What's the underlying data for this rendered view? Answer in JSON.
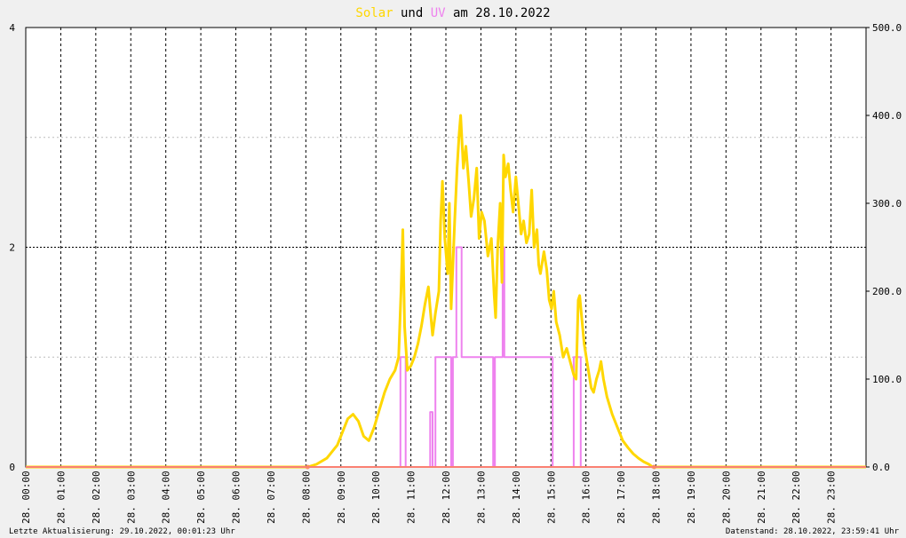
{
  "chart_data": {
    "type": "line",
    "title_parts": [
      {
        "text": "Solar",
        "color": "#FFD700"
      },
      {
        "text": " und ",
        "color": "#000000"
      },
      {
        "text": "UV",
        "color": "#EE82EE"
      },
      {
        "text": " am 28.10.2022",
        "color": "#000000"
      }
    ],
    "x_unit": "hours",
    "xlim": [
      0,
      24
    ],
    "x_tick_labels": [
      "28. 00:00",
      "28. 01:00",
      "28. 02:00",
      "28. 03:00",
      "28. 04:00",
      "28. 05:00",
      "28. 06:00",
      "28. 07:00",
      "28. 08:00",
      "28. 09:00",
      "28. 10:00",
      "28. 11:00",
      "28. 12:00",
      "28. 13:00",
      "28. 14:00",
      "28. 15:00",
      "28. 16:00",
      "28. 17:00",
      "28. 18:00",
      "28. 19:00",
      "28. 20:00",
      "28. 21:00",
      "28. 22:00",
      "28. 23:00"
    ],
    "y_left": {
      "lim": [
        0,
        4
      ],
      "ticks": [
        0,
        2,
        4
      ],
      "tick_labels": [
        "0",
        "2",
        "4"
      ],
      "minor_ticks": [
        1,
        3
      ]
    },
    "y_right": {
      "lim": [
        0,
        500
      ],
      "ticks": [
        0,
        100,
        200,
        300,
        400,
        500
      ],
      "tick_labels": [
        "0.0",
        "100.0",
        "200.0",
        "300.0",
        "400.0",
        "500.0"
      ]
    },
    "grid": true,
    "series": [
      {
        "name": "Solar",
        "color": "#FFD700",
        "axis": "right",
        "points": [
          [
            0,
            0
          ],
          [
            8.05,
            0
          ],
          [
            8.3,
            3
          ],
          [
            8.6,
            10
          ],
          [
            8.9,
            25
          ],
          [
            9.05,
            40
          ],
          [
            9.2,
            55
          ],
          [
            9.35,
            60
          ],
          [
            9.5,
            52
          ],
          [
            9.65,
            35
          ],
          [
            9.8,
            30
          ],
          [
            9.95,
            45
          ],
          [
            10.1,
            65
          ],
          [
            10.25,
            85
          ],
          [
            10.4,
            100
          ],
          [
            10.55,
            110
          ],
          [
            10.65,
            125
          ],
          [
            10.72,
            200
          ],
          [
            10.77,
            270
          ],
          [
            10.82,
            160
          ],
          [
            10.9,
            110
          ],
          [
            11.0,
            115
          ],
          [
            11.1,
            125
          ],
          [
            11.2,
            140
          ],
          [
            11.3,
            160
          ],
          [
            11.4,
            185
          ],
          [
            11.5,
            205
          ],
          [
            11.55,
            180
          ],
          [
            11.62,
            150
          ],
          [
            11.7,
            175
          ],
          [
            11.8,
            200
          ],
          [
            11.85,
            280
          ],
          [
            11.9,
            325
          ],
          [
            11.97,
            260
          ],
          [
            12.05,
            220
          ],
          [
            12.1,
            300
          ],
          [
            12.15,
            180
          ],
          [
            12.25,
            280
          ],
          [
            12.32,
            340
          ],
          [
            12.38,
            380
          ],
          [
            12.42,
            400
          ],
          [
            12.5,
            340
          ],
          [
            12.57,
            365
          ],
          [
            12.65,
            325
          ],
          [
            12.72,
            285
          ],
          [
            12.8,
            305
          ],
          [
            12.88,
            340
          ],
          [
            12.95,
            260
          ],
          [
            13.02,
            290
          ],
          [
            13.1,
            280
          ],
          [
            13.2,
            240
          ],
          [
            13.3,
            260
          ],
          [
            13.38,
            195
          ],
          [
            13.42,
            170
          ],
          [
            13.48,
            250
          ],
          [
            13.55,
            300
          ],
          [
            13.6,
            210
          ],
          [
            13.65,
            355
          ],
          [
            13.7,
            330
          ],
          [
            13.78,
            345
          ],
          [
            13.85,
            315
          ],
          [
            13.92,
            290
          ],
          [
            14.0,
            330
          ],
          [
            14.08,
            295
          ],
          [
            14.15,
            265
          ],
          [
            14.22,
            280
          ],
          [
            14.3,
            255
          ],
          [
            14.38,
            265
          ],
          [
            14.45,
            315
          ],
          [
            14.52,
            250
          ],
          [
            14.6,
            270
          ],
          [
            14.65,
            230
          ],
          [
            14.7,
            220
          ],
          [
            14.8,
            245
          ],
          [
            14.88,
            225
          ],
          [
            14.95,
            190
          ],
          [
            15.02,
            180
          ],
          [
            15.08,
            200
          ],
          [
            15.15,
            165
          ],
          [
            15.25,
            150
          ],
          [
            15.35,
            125
          ],
          [
            15.45,
            135
          ],
          [
            15.55,
            120
          ],
          [
            15.65,
            105
          ],
          [
            15.72,
            100
          ],
          [
            15.78,
            190
          ],
          [
            15.82,
            195
          ],
          [
            15.88,
            170
          ],
          [
            15.95,
            140
          ],
          [
            16.05,
            115
          ],
          [
            16.15,
            90
          ],
          [
            16.22,
            85
          ],
          [
            16.3,
            100
          ],
          [
            16.38,
            110
          ],
          [
            16.43,
            120
          ],
          [
            16.5,
            100
          ],
          [
            16.6,
            80
          ],
          [
            16.75,
            60
          ],
          [
            16.9,
            45
          ],
          [
            17.05,
            30
          ],
          [
            17.2,
            22
          ],
          [
            17.35,
            15
          ],
          [
            17.5,
            10
          ],
          [
            17.65,
            6
          ],
          [
            17.8,
            3
          ],
          [
            17.9,
            0
          ],
          [
            24,
            0
          ]
        ]
      },
      {
        "name": "UV",
        "color": "#EE82EE",
        "axis": "left",
        "points": [
          [
            0,
            0
          ],
          [
            10.7,
            0
          ],
          [
            10.7,
            1
          ],
          [
            10.85,
            1
          ],
          [
            10.85,
            0
          ],
          [
            11.55,
            0
          ],
          [
            11.55,
            0.5
          ],
          [
            11.62,
            0.5
          ],
          [
            11.62,
            0
          ],
          [
            11.7,
            0
          ],
          [
            11.7,
            1
          ],
          [
            12.15,
            1
          ],
          [
            12.15,
            0
          ],
          [
            12.2,
            0
          ],
          [
            12.2,
            1
          ],
          [
            12.3,
            1
          ],
          [
            12.3,
            2
          ],
          [
            12.45,
            2
          ],
          [
            12.45,
            1
          ],
          [
            13.35,
            1
          ],
          [
            13.35,
            0
          ],
          [
            13.4,
            0
          ],
          [
            13.4,
            1
          ],
          [
            13.62,
            1
          ],
          [
            13.62,
            2
          ],
          [
            13.67,
            2
          ],
          [
            13.67,
            1
          ],
          [
            15.05,
            1
          ],
          [
            15.05,
            0
          ],
          [
            15.65,
            0
          ],
          [
            15.65,
            1
          ],
          [
            15.85,
            1
          ],
          [
            15.85,
            0
          ],
          [
            24,
            0
          ]
        ]
      },
      {
        "name": "baseline",
        "color": "#FA8072",
        "axis": "left",
        "points": [
          [
            0,
            0
          ],
          [
            24,
            0
          ]
        ]
      }
    ]
  },
  "footer": {
    "left": "Letzte Aktualisierung: 29.10.2022, 00:01:23 Uhr",
    "right": "Datenstand: 28.10.2022, 23:59:41 Uhr"
  }
}
